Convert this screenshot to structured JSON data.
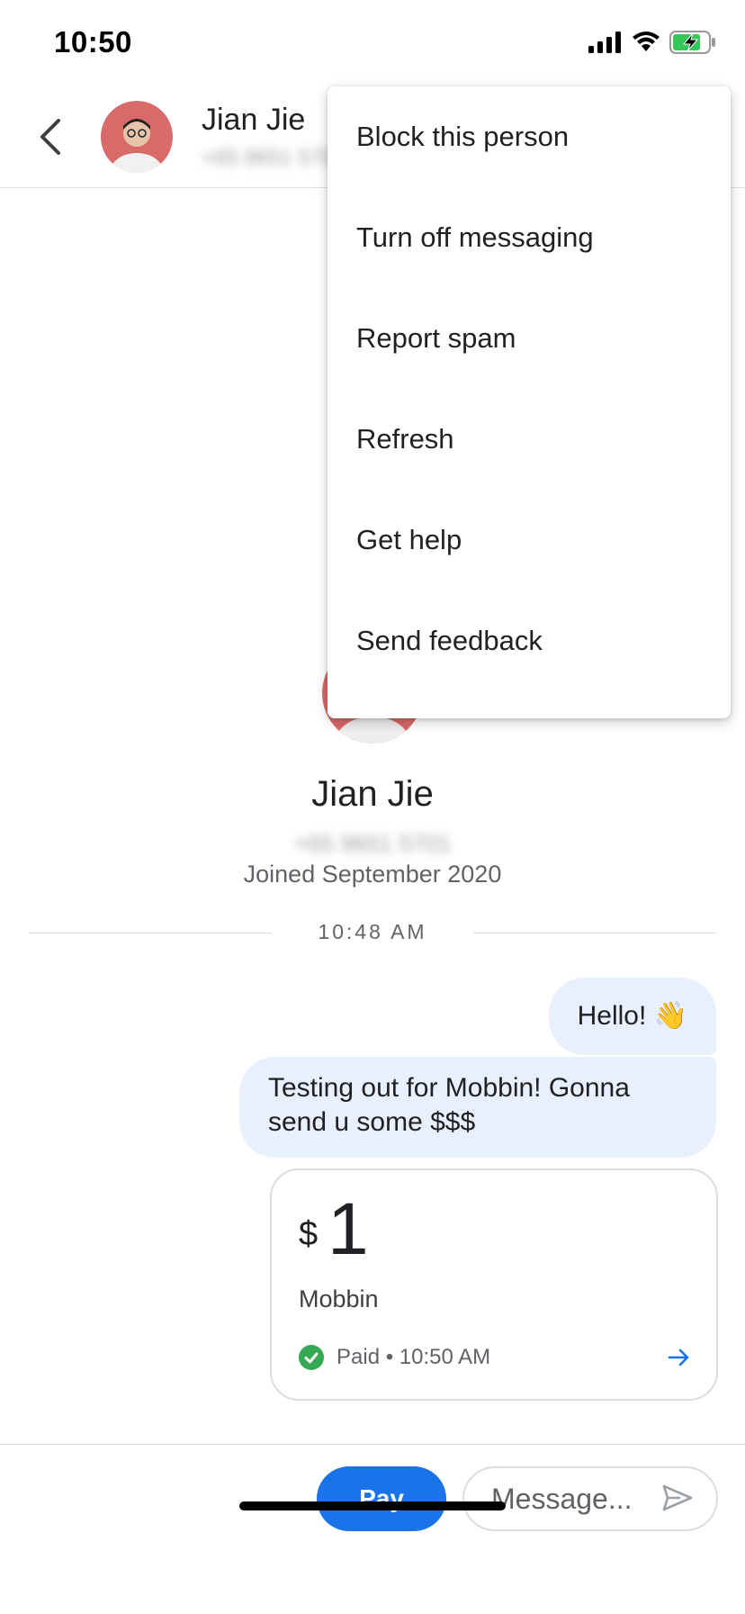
{
  "status_bar": {
    "time": "10:50",
    "icons": [
      "signal-icon",
      "wifi-icon",
      "battery-charging-icon"
    ]
  },
  "header": {
    "back_icon": "chevron-left-icon",
    "contact_name": "Jian Jie",
    "contact_phone": "+65 9651 5701"
  },
  "profile": {
    "name": "Jian Jie",
    "phone": "+65 9651 5701",
    "joined": "Joined September 2020"
  },
  "conversation": {
    "time_divider": "10:48 AM",
    "messages": [
      {
        "text": "Hello! 👋"
      },
      {
        "text": "Testing out for Mobbin! Gonna send u some $$$"
      }
    ],
    "payment": {
      "currency": "$",
      "amount": "1",
      "merchant": "Mobbin",
      "status": "Paid • 10:50 AM"
    }
  },
  "footer": {
    "pay_label": "Pay",
    "message_placeholder": "Message..."
  },
  "menu": {
    "items": [
      {
        "label": "Block this person"
      },
      {
        "label": "Turn off messaging"
      },
      {
        "label": "Report spam"
      },
      {
        "label": "Refresh"
      },
      {
        "label": "Get help"
      },
      {
        "label": "Send feedback"
      }
    ]
  },
  "colors": {
    "accent": "#1a73e8",
    "bubble": "#e8f0fe",
    "paid_green": "#34a853",
    "avatar_bg": "#d96a6a"
  }
}
